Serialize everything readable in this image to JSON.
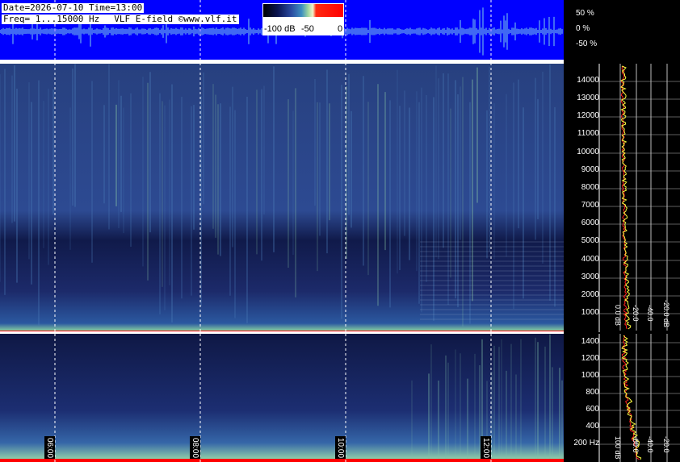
{
  "header": {
    "date_label": "Date=2026-07-10",
    "time_label": "Time=13:00",
    "freq_label": "Freq= 1...15000 Hz",
    "source_label": "VLF E-field ©www.vlf.it"
  },
  "colorbar": {
    "ticks": [
      "-100 dB",
      "-50",
      "0"
    ]
  },
  "waveform_axis": {
    "labels": [
      "50 %",
      "0 %",
      "-50 %"
    ]
  },
  "upper_panel": {
    "freq_ticks": [
      "14000",
      "13000",
      "12000",
      "11000",
      "10000",
      "9000",
      "8000",
      "7000",
      "6000",
      "5000",
      "4000",
      "3000",
      "2000",
      "1000"
    ],
    "db_ticks": [
      "0.0 dB",
      "-20.0",
      "-40.0",
      "-20.0 dB"
    ]
  },
  "lower_panel": {
    "freq_ticks": [
      "1400",
      "1200",
      "1000",
      "800",
      "600",
      "400",
      "200 Hz"
    ],
    "db_ticks": [
      "100 dB",
      "-80.0",
      "-40.0",
      "-20.0"
    ]
  },
  "time_axis": {
    "labels": [
      "06:00",
      "08:00",
      "10:00",
      "12:00"
    ]
  },
  "colors": {
    "waveform_bg": "#0000ff",
    "spectrogram_dark": "#0b1240",
    "spectrogram_mid": "#2a3f8f",
    "spectrogram_bright": "#7fc79a",
    "noise_floor": "#ff0000",
    "trace_yellow": "#ffff40",
    "trace_red": "#ff2020"
  }
}
